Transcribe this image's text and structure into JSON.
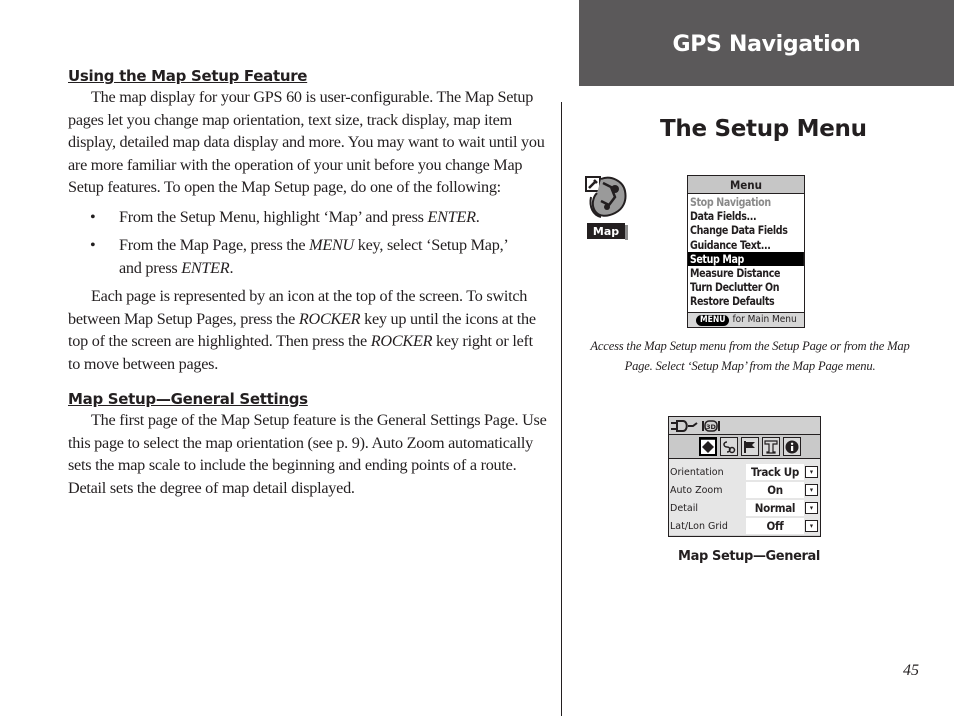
{
  "header": {
    "section_title": "GPS Navigation",
    "band_color": "#5b595a"
  },
  "right": {
    "title": "The Setup Menu",
    "map_icon_label": "Map",
    "menu_screen": {
      "title": "Menu",
      "items": [
        {
          "label": "Stop Navigation",
          "state": "disabled"
        },
        {
          "label": "Data Fields...",
          "state": "normal"
        },
        {
          "label": "Change Data Fields",
          "state": "normal"
        },
        {
          "label": "Guidance Text...",
          "state": "normal"
        },
        {
          "label": "Setup Map",
          "state": "selected"
        },
        {
          "label": "Measure Distance",
          "state": "normal"
        },
        {
          "label": "Turn Declutter On",
          "state": "normal"
        },
        {
          "label": "Restore Defaults",
          "state": "normal"
        }
      ],
      "footer_key": "MENU",
      "footer_text": "for Main Menu"
    },
    "menu_caption": "Access the Map Setup menu from the Setup Page or from the Map Page. Select ‘Setup Map’ from the Map Page menu.",
    "setup_screen": {
      "status_icons": [
        "power-plug-icon",
        "3d-mode-icon"
      ],
      "status_3d_text": "3D",
      "tabs": [
        {
          "icon": "map-orientation-icon",
          "glyph": "◆",
          "active": true
        },
        {
          "icon": "track-icon",
          "glyph": "ꝸ",
          "active": false
        },
        {
          "icon": "flag-icon",
          "glyph": "⚑",
          "active": false
        },
        {
          "icon": "text-icon",
          "glyph": "T",
          "active": false
        },
        {
          "icon": "info-icon",
          "glyph": "i",
          "active": false
        }
      ],
      "settings": [
        {
          "label": "Orientation",
          "value": "Track Up"
        },
        {
          "label": "Auto Zoom",
          "value": "On"
        },
        {
          "label": "Detail",
          "value": "Normal"
        },
        {
          "label": "Lat/Lon Grid",
          "value": "Off"
        }
      ],
      "dropdown_glyph": "▾"
    },
    "setup_caption": "Map Setup—General"
  },
  "left": {
    "section1": {
      "heading": "Using the Map Setup Feature",
      "para1": "The map display for your GPS 60 is user-configurable. The Map Setup pages let you change map orientation, text size, track display, map item display, detailed map data display and more. You may want to wait until you are more familiar with the operation of your unit before you change Map Setup features. To open the Map Setup page, do one of the following:",
      "bullet_char": "•",
      "bullet1": {
        "pre": "From the Setup Menu, highlight ‘Map’ and press ",
        "key": "ENTER",
        "post": "."
      },
      "bullet2": {
        "pre": "From the Map Page, press the ",
        "key1": "MENU",
        "mid": " key, select ‘Setup Map,’ and press ",
        "key2": "ENTER",
        "post": "."
      },
      "para2": {
        "pre": "Each page is represented by an icon at the top of the screen. To switch between Map Setup Pages, press the ",
        "key1": "ROCKER",
        "mid": " key up until the icons at the top of the screen are highlighted. Then press the ",
        "key2": "ROCKER",
        "post": " key right or left to move between pages."
      }
    },
    "section2": {
      "heading": "Map Setup—General Settings",
      "para1": "The first page of the Map Setup feature is the General Settings Page. Use this page to select the map orientation (see p. 9). Auto Zoom automatically sets the map scale to include the beginning and ending points of a route. Detail sets the degree of map detail displayed."
    }
  },
  "page_number": "45"
}
